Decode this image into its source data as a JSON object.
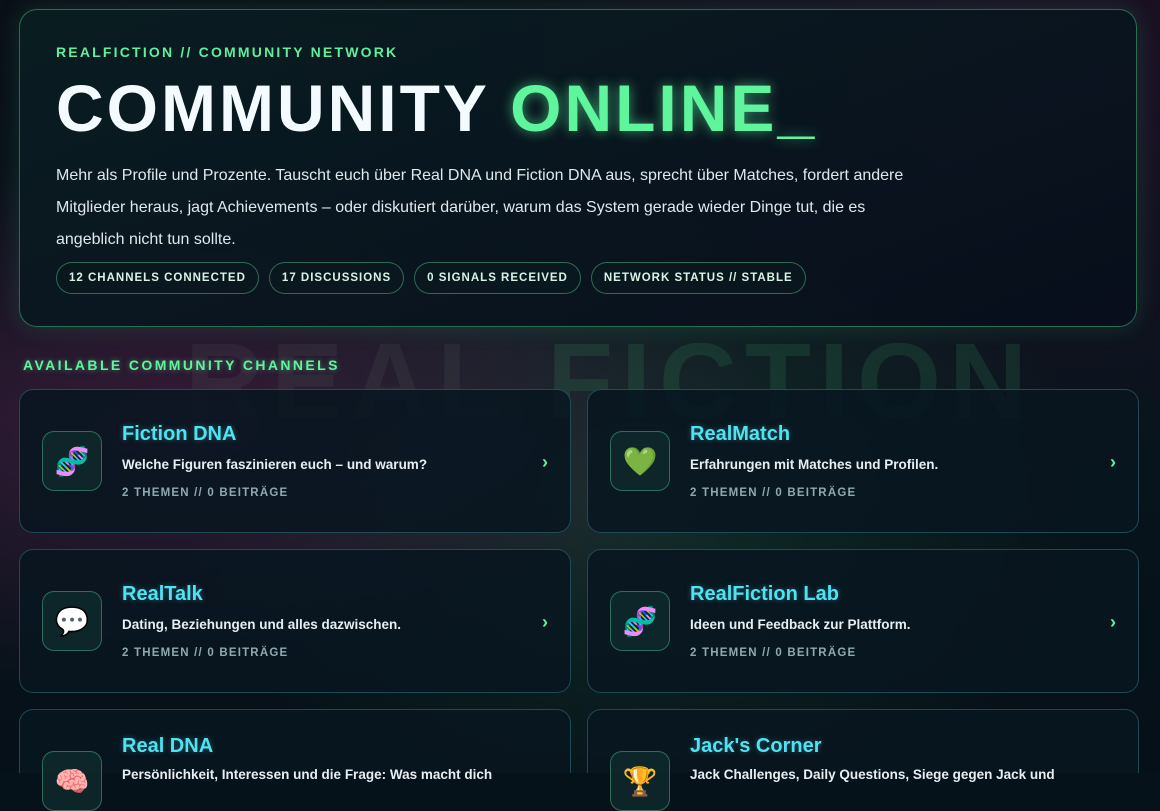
{
  "hero": {
    "eyebrow": "REALFICTION // COMMUNITY NETWORK",
    "title_main": "COMMUNITY ",
    "title_accent": "ONLINE_",
    "description": "Mehr als Profile und Prozente. Tauscht euch über Real DNA und Fiction DNA aus, sprecht über Matches, fordert andere Mitglieder heraus, jagt Achievements – oder diskutiert darüber, warum das System gerade wieder Dinge tut, die es angeblich nicht tun sollte.",
    "stats": [
      "12 CHANNELS CONNECTED",
      "17 DISCUSSIONS",
      "0 SIGNALS RECEIVED",
      "NETWORK STATUS // STABLE"
    ]
  },
  "background_word": {
    "part1": "REAL",
    "part2": "FICTION"
  },
  "section_label": "AVAILABLE COMMUNITY CHANNELS",
  "channels": [
    {
      "title": "Fiction DNA",
      "description": "Welche Figuren faszinieren euch – und warum?",
      "meta": "2 THEMEN // 0 BEITRÄGE",
      "icon": "🧬",
      "icon_name": "dna-icon",
      "chevron": "›"
    },
    {
      "title": "RealMatch",
      "description": "Erfahrungen mit Matches und Profilen.",
      "meta": "2 THEMEN // 0 BEITRÄGE",
      "icon": "💚",
      "icon_name": "green-heart-icon",
      "chevron": "›"
    },
    {
      "title": "RealTalk",
      "description": "Dating, Beziehungen und alles dazwischen.",
      "meta": "2 THEMEN // 0 BEITRÄGE",
      "icon": "💬",
      "icon_name": "speech-bubble-icon",
      "chevron": "›"
    },
    {
      "title": "RealFiction Lab",
      "description": "Ideen und Feedback zur Plattform.",
      "meta": "2 THEMEN // 0 BEITRÄGE",
      "icon": "🧬",
      "icon_name": "dna-icon",
      "chevron": "›"
    },
    {
      "title": "Real DNA",
      "description": "Persönlichkeit, Interessen und die Frage: Was macht dich",
      "meta": "",
      "icon": "🧠",
      "icon_name": "brain-icon",
      "chevron": ""
    },
    {
      "title": "Jack's Corner",
      "description": "Jack Challenges, Daily Questions, Siege gegen Jack und",
      "meta": "",
      "icon": "🏆",
      "icon_name": "trophy-icon",
      "chevron": ""
    }
  ]
}
